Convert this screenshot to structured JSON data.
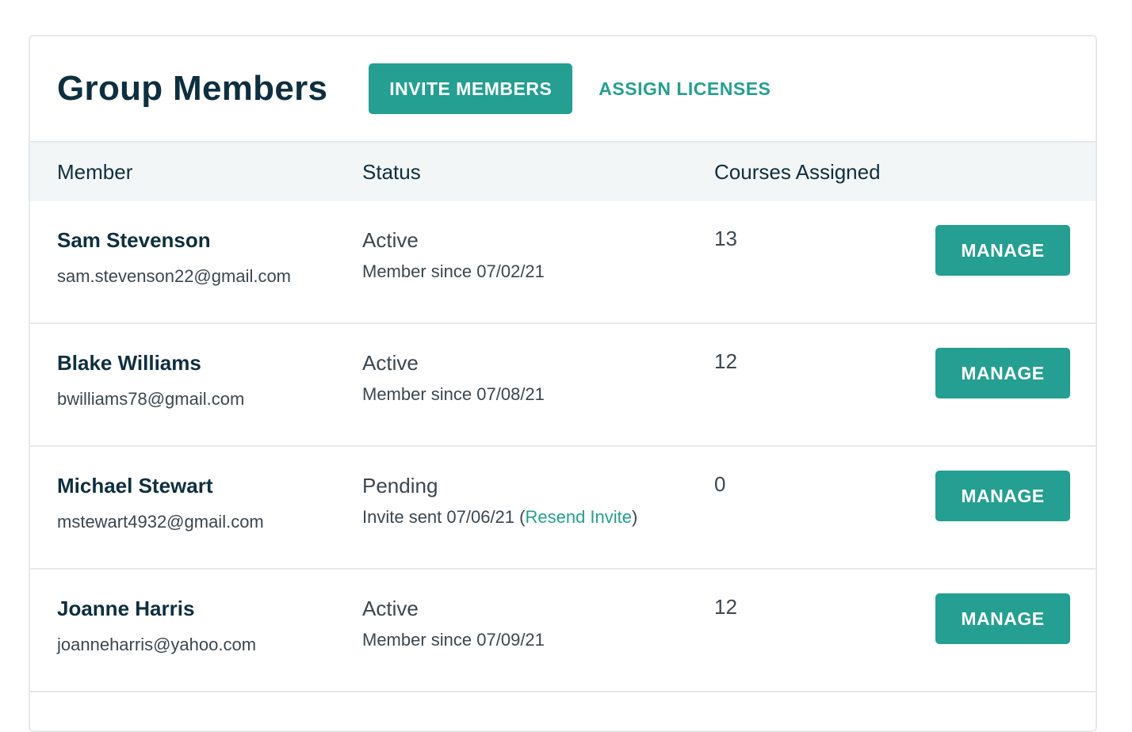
{
  "header": {
    "title": "Group Members",
    "invite_label": "INVITE MEMBERS",
    "assign_label": "ASSIGN LICENSES"
  },
  "table": {
    "columns": [
      "Member",
      "Status",
      "Courses Assigned"
    ],
    "rows": [
      {
        "name": "Sam Stevenson",
        "email": "sam.stevenson22@gmail.com",
        "status": "Active",
        "detail": "Member since 07/02/21",
        "courses": "13",
        "action": "MANAGE"
      },
      {
        "name": "Blake Williams",
        "email": "bwilliams78@gmail.com",
        "status": "Active",
        "detail": "Member since 07/08/21",
        "courses": "12",
        "action": "MANAGE"
      },
      {
        "name": "Michael Stewart",
        "email": "mstewart4932@gmail.com",
        "status": "Pending",
        "detail": "Invite sent 07/06/21 (",
        "detail_link": "Resend Invite",
        "detail_suffix": ")",
        "courses": "0",
        "action": "MANAGE"
      },
      {
        "name": "Joanne Harris",
        "email": "joanneharris@yahoo.com",
        "status": "Active",
        "detail": "Member since 07/09/21",
        "courses": "12",
        "action": "MANAGE"
      }
    ]
  },
  "colors": {
    "accent": "#249f91",
    "heading": "#0e2f3f",
    "header_bg": "#f3f6f7",
    "border": "#e6e9eb"
  }
}
